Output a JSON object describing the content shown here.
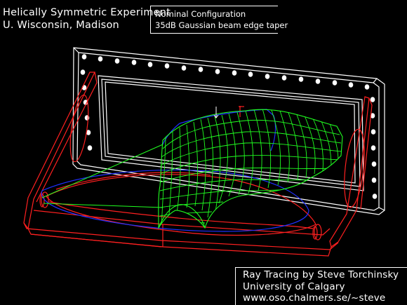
{
  "header": {
    "title": "Helically Symmetric Experiment",
    "institution": "U. Wisconsin, Madison"
  },
  "config": {
    "line1": "Nominal Configuration",
    "line2": "35dB Gaussian beam edge taper"
  },
  "credits": {
    "line1": "Ray Tracing by Steve Torchinsky",
    "line2": "University of Calgary",
    "line3": "www.oso.chalmers.se/~steve"
  },
  "colors": {
    "background": "#000000",
    "housing": "#ffffff",
    "mirror_frame": "#ff2020",
    "ellipse_outline": "#2030ff",
    "beam_mesh": "#20ff20",
    "text": "#ffffff"
  }
}
